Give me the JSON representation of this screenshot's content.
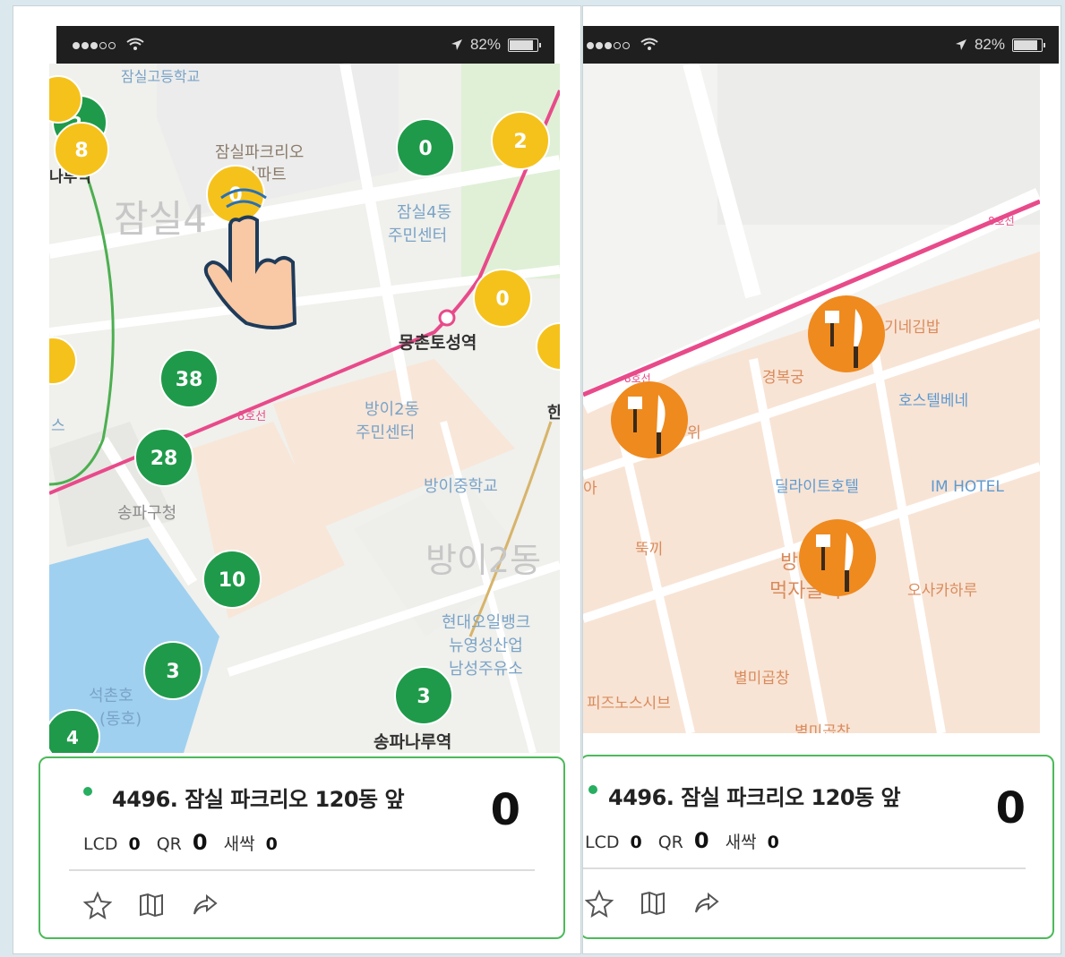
{
  "status_bar": {
    "battery": "82%"
  },
  "left_map": {
    "labels": {
      "school_top": "잠실고등학교",
      "apartment": "잠실파크리오\n아파트",
      "district": "잠실4",
      "community_center_4": "잠실4동\n주민센터",
      "station_mongchon": "몽촌토성역",
      "community_center_bangi2": "방이2동\n주민센터",
      "school_bangi": "방이중학교",
      "district_bangi2": "방이2동",
      "gas_station": "현대오일뱅크\n뉴영성산업\n남성주유소",
      "office_songpa": "송파구청",
      "lake": "석촌호\n(동호)",
      "station_songpanaru": "송파나루역",
      "line_label": "8호선",
      "left_edge": "나루역",
      "left_edge2": "스",
      "right_edge": "한"
    },
    "markers": [
      {
        "count": "0",
        "color": "#1f9a4a"
      },
      {
        "count": "2",
        "color": "#f5c21c"
      },
      {
        "count": "0",
        "color": "#f5c21c"
      },
      {
        "count": "0",
        "color": "#f5c21c"
      },
      {
        "count": "8",
        "color": "#f5c21c"
      },
      {
        "count": "2",
        "color": "#1f9a4a"
      },
      {
        "count": "38",
        "color": "#1f9a4a"
      },
      {
        "count": "28",
        "color": "#1f9a4a"
      },
      {
        "count": "10",
        "color": "#1f9a4a"
      },
      {
        "count": "3",
        "color": "#1f9a4a"
      },
      {
        "count": "3",
        "color": "#1f9a4a"
      },
      {
        "count": "4",
        "color": "#1f9a4a"
      }
    ]
  },
  "right_map": {
    "labels": {
      "line_label": "8호선",
      "gimbap": "기네김밥",
      "gyeongbokgung": "경복궁",
      "hostel": "호스텔베네",
      "delight_hotel": "딜라이트호텔",
      "im_hotel": "IM HOTEL",
      "ttukki": "뚝끼",
      "bang": "방",
      "food_alley": "먹자골목",
      "osaka": "오사카하루",
      "byulmi": "별미곱창",
      "pizza": "피즈노스시브",
      "byulmi2": "별미곱창",
      "left_partial": "아",
      "wi": "위"
    }
  },
  "card": {
    "station": "4496. 잠실 파크리오 120동 앞",
    "count": "0",
    "lcd_label": "LCD",
    "lcd_value": "0",
    "qr_label": "QR",
    "qr_value": "0",
    "new_label": "새싹",
    "new_value": "0"
  },
  "icons": [
    "wifi-icon",
    "location-arrow-icon",
    "battery-icon",
    "hand-pointer-icon",
    "restaurant-icon",
    "star-icon",
    "map-icon",
    "share-icon"
  ]
}
